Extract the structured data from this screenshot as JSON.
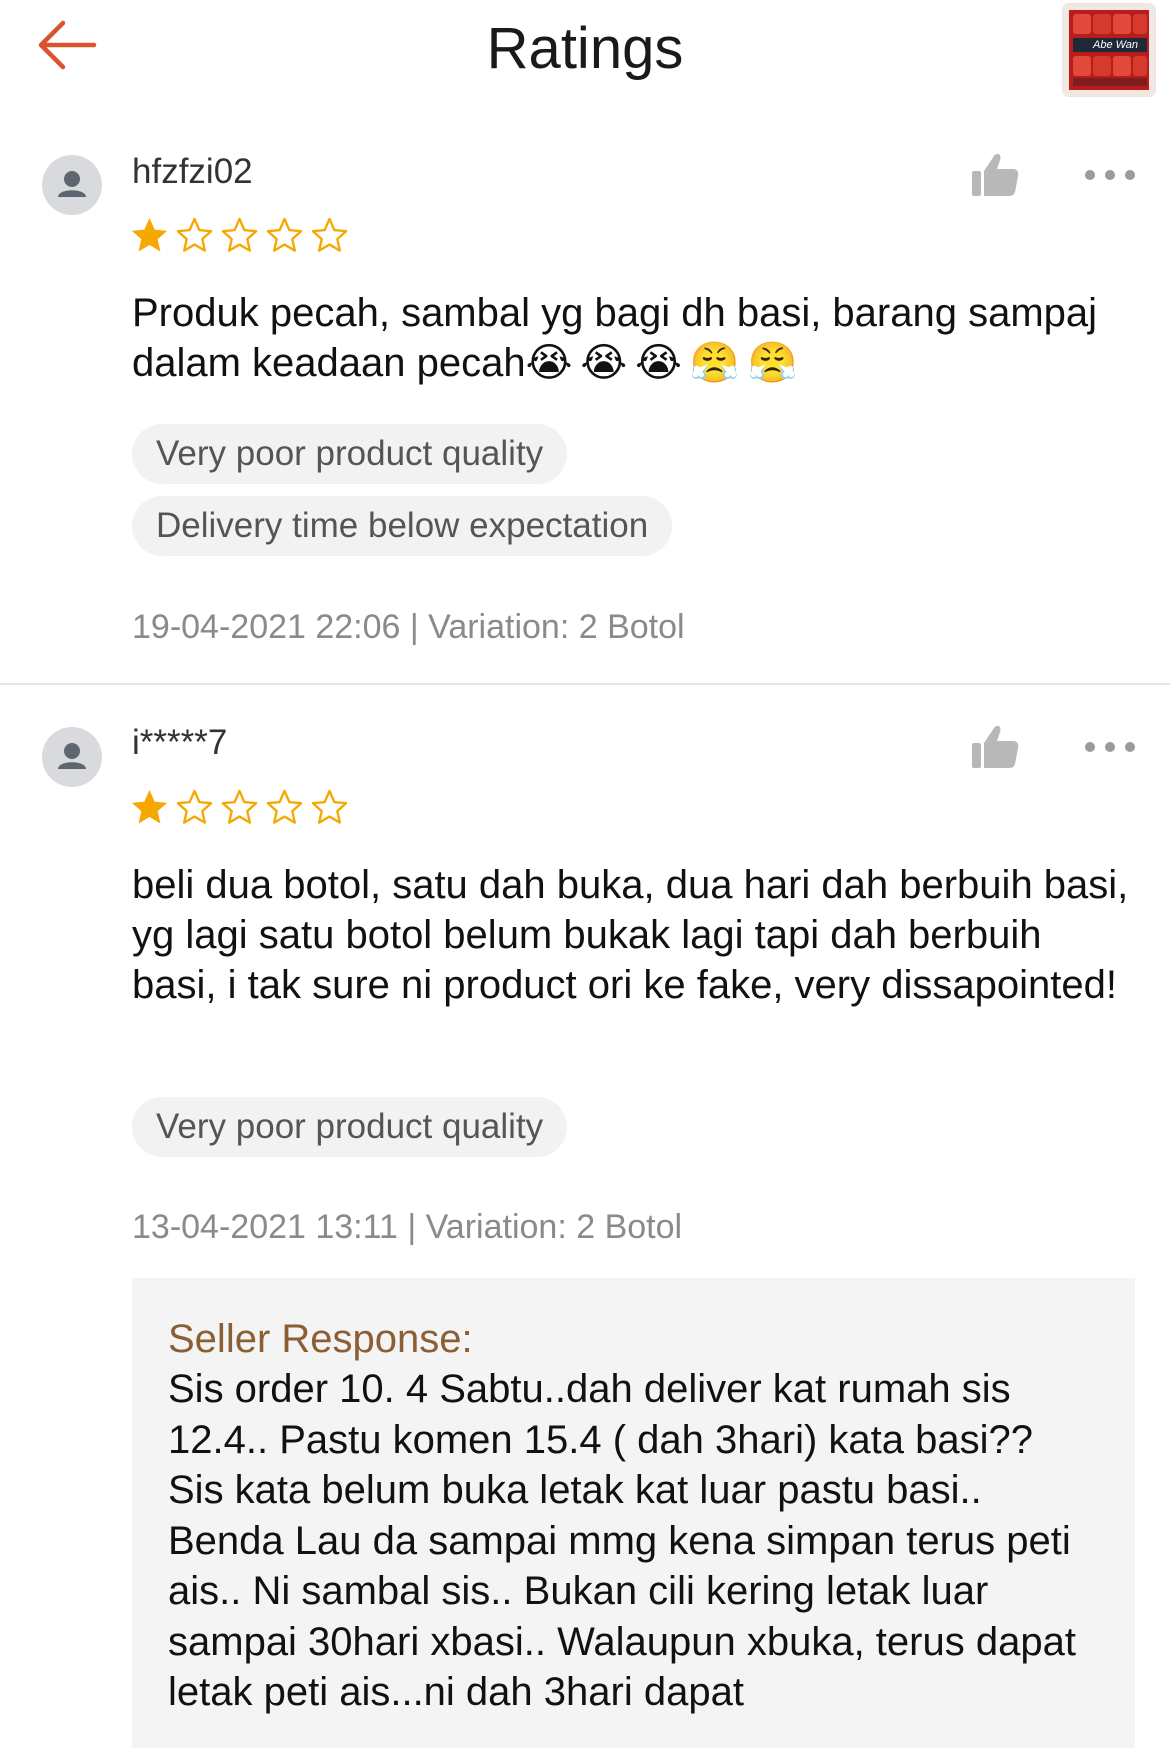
{
  "header": {
    "title": "Ratings",
    "back_icon": "arrow-left-icon",
    "accent_color": "#d9542c",
    "product_thumb_label": "Abe Wan"
  },
  "reviews": [
    {
      "username": "hfzfzi02",
      "rating": 1,
      "max_rating": 5,
      "comment": "Produk pecah, sambal yg bagi dh basi, barang sampaj dalam keadaan pecah",
      "emojis": "😭😭😭😤😤",
      "tags": [
        "Very poor product quality",
        "Delivery time below expectation"
      ],
      "meta": "19-04-2021 22:06 | Variation: 2 Botol"
    },
    {
      "username": "i*****7",
      "rating": 1,
      "max_rating": 5,
      "comment": "beli dua botol, satu dah buka, dua hari dah berbuih basi, yg lagi satu botol belum bukak lagi tapi dah berbuih basi, i tak sure ni product ori ke fake, very dissapointed!",
      "tags": [
        "Very poor product quality"
      ],
      "meta": "13-04-2021 13:11 | Variation: 2 Botol",
      "seller_response": {
        "label": "Seller Response:",
        "text": "Sis order 10. 4 Sabtu..dah deliver kat rumah sis 12.4.. Pastu komen 15.4 ( dah 3hari) kata basi?? Sis kata belum buka letak kat luar pastu basi.. Benda Lau da sampai mmg kena simpan terus peti ais.. Ni sambal sis.. Bukan cili kering letak luar sampai 30hari xbasi.. Walaupun xbuka, terus dapat letak peti ais...ni dah 3hari dapat"
      }
    }
  ],
  "colors": {
    "star_filled": "#f6a700",
    "star_empty": "#f6a700",
    "seller_label": "#8b5e34"
  }
}
